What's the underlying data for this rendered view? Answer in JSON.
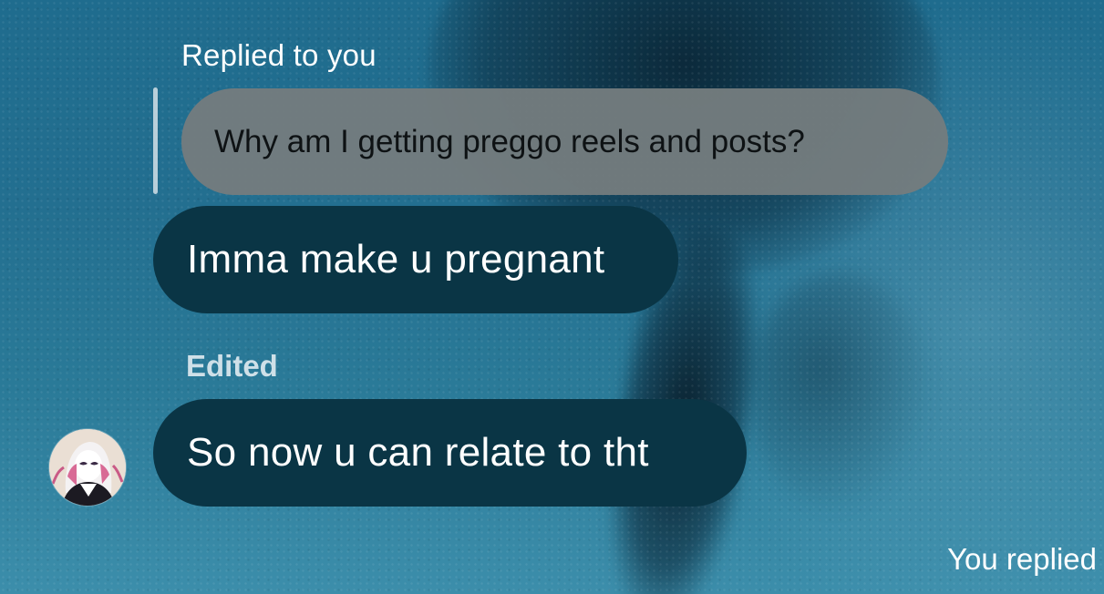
{
  "reply_context": {
    "caption": "Replied to you",
    "quoted_text": "Why am I getting preggo reels and posts?"
  },
  "messages": [
    {
      "text": "Imma make u pregnant"
    },
    {
      "edited_label": "Edited",
      "text": "So now u can relate to tht"
    }
  ],
  "sender": {
    "avatar_icon": "avatar-icon"
  },
  "footer": {
    "caption": "You replied"
  },
  "colors": {
    "background": "#236f90",
    "message_bubble": "#0a3545",
    "quoted_bubble": "#747c7e",
    "text_primary": "#ffffff",
    "edited_label": "#cfe0e8"
  }
}
